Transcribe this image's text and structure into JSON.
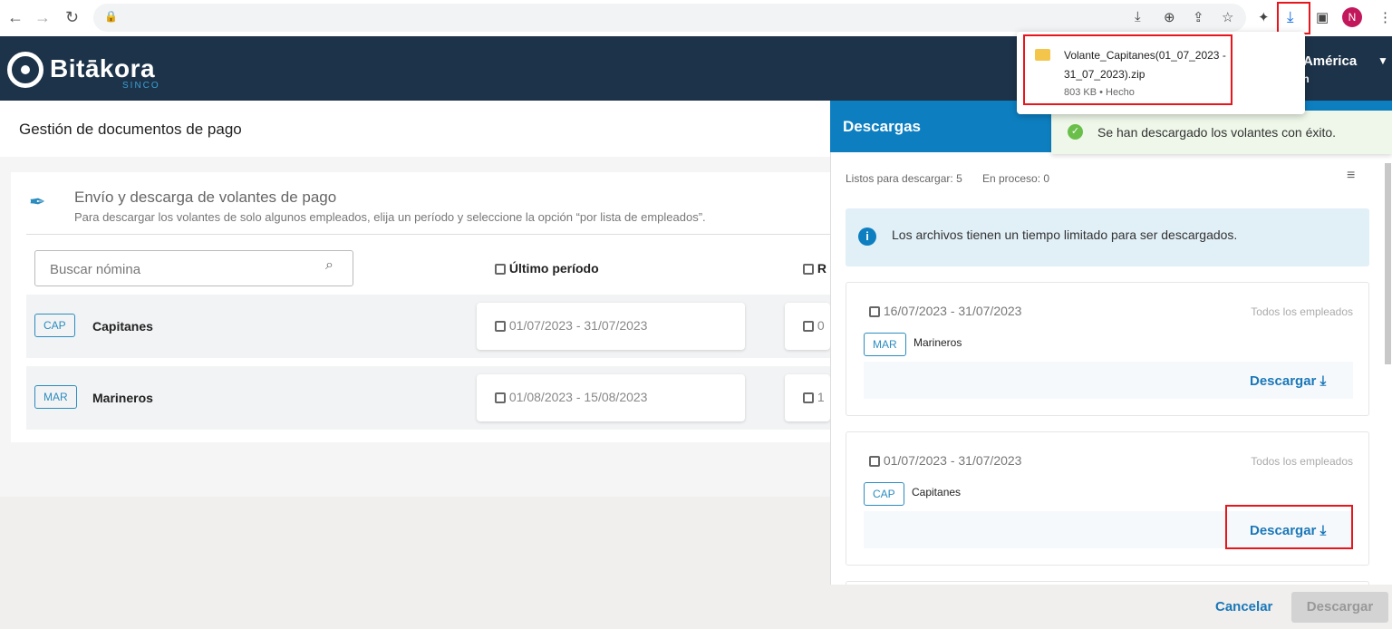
{
  "browser": {
    "download_popup": {
      "filename_line1": "Volante_Capitanes(01_07_2023 -",
      "filename_line2": "31_07_2023).zip",
      "status": "803 KB • Hecho"
    },
    "avatar": "N"
  },
  "app": {
    "logo": "Bitākora",
    "logo_sub": "SINCO",
    "user_name": "a América",
    "user_role": "ón"
  },
  "page": {
    "title": "Gestión de documentos de pago",
    "section_title": "Envío y descarga de volantes de pago",
    "section_desc": "Para descargar los volantes de solo algunos empleados, elija un período y seleccione la opción “por lista de empleados”.",
    "search_placeholder": "Buscar nómina",
    "col1": "Último período",
    "col2": "R",
    "rows": [
      {
        "code": "CAP",
        "name": "Capitanes",
        "period": "01/07/2023 - 31/07/2023",
        "period2": "0"
      },
      {
        "code": "MAR",
        "name": "Marineros",
        "period": "01/08/2023 - 15/08/2023",
        "period2": "1"
      }
    ]
  },
  "panel": {
    "title": "Descargas",
    "ready": "Listos para descargar: 5",
    "in_process": "En proceso: 0",
    "info": "Los archivos tienen un tiempo limitado para ser descargados.",
    "items": [
      {
        "period": "16/07/2023 - 31/07/2023",
        "scope": "Todos los empleados",
        "code": "MAR",
        "name": "Marineros",
        "button": "Descargar"
      },
      {
        "period": "01/07/2023 - 31/07/2023",
        "scope": "Todos los empleados",
        "code": "CAP",
        "name": "Capitanes",
        "button": "Descargar"
      }
    ],
    "cancel": "Cancelar",
    "download": "Descargar"
  },
  "toast": {
    "message": "Se han descargado los volantes con éxito.",
    "color": "#6abf4b"
  },
  "colors": {
    "header": "#1d3349",
    "accent": "#0d7fc0",
    "highlight": "#e8151c"
  }
}
